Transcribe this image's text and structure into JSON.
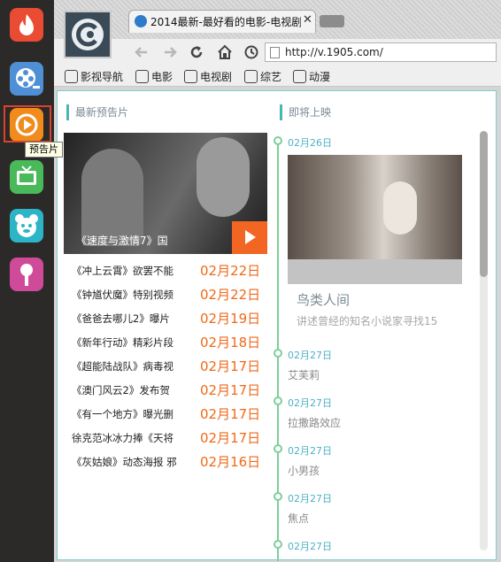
{
  "dock": {
    "apps": [
      {
        "icon": "flame-app-icon",
        "color": "#e94b33"
      },
      {
        "icon": "film-reel-app-icon",
        "color": "#4f8fd6"
      },
      {
        "icon": "play-circle-app-icon",
        "color": "#f08b1c"
      },
      {
        "icon": "tv-app-icon",
        "color": "#49b95a"
      },
      {
        "icon": "bear-face-app-icon",
        "color": "#2cb4c7"
      },
      {
        "icon": "microphone-app-icon",
        "color": "#cf4b9a"
      }
    ],
    "tooltip": "预告片"
  },
  "browser": {
    "tab_title": "2014最新-最好看的电影-电视剧",
    "tab_close": "✕",
    "address": "http://v.1905.com/",
    "bookmarks": [
      "影视导航",
      "电影",
      "电视剧",
      "综艺",
      "动漫"
    ]
  },
  "trailers": {
    "heading": "最新预告片",
    "feature_caption": "《速度与激情7》国",
    "items": [
      {
        "title": "《冲上云霄》欲罢不能",
        "date": "02月22日"
      },
      {
        "title": "《钟馗伏魔》特别视频",
        "date": "02月22日"
      },
      {
        "title": "《爸爸去哪儿2》曝片",
        "date": "02月19日"
      },
      {
        "title": "《新年行动》精彩片段",
        "date": "02月18日"
      },
      {
        "title": "《超能陆战队》病毒视",
        "date": "02月17日"
      },
      {
        "title": "《澳门风云2》发布贺",
        "date": "02月17日"
      },
      {
        "title": "《有一个地方》曝光删",
        "date": "02月17日"
      },
      {
        "title": "徐克范冰冰力捧《天将",
        "date": "02月17日"
      },
      {
        "title": "《灰姑娘》动态海报 邪",
        "date": "02月16日"
      }
    ]
  },
  "upcoming": {
    "heading": "即将上映",
    "featured": {
      "date": "02月26日",
      "title": "鸟类人间",
      "desc": "讲述曾经的知名小说家寻找15"
    },
    "items": [
      {
        "date": "02月27日",
        "title": "艾芙莉"
      },
      {
        "date": "02月27日",
        "title": "拉撒路效应"
      },
      {
        "date": "02月27日",
        "title": "小男孩"
      },
      {
        "date": "02月27日",
        "title": "焦点"
      },
      {
        "date": "02月27日",
        "title": ""
      }
    ]
  },
  "colors": {
    "accent_orange": "#f26522",
    "timeline_green": "#7ccf9b",
    "date_blue": "#4fb0c6",
    "panel_border": "#7fcdcf"
  }
}
